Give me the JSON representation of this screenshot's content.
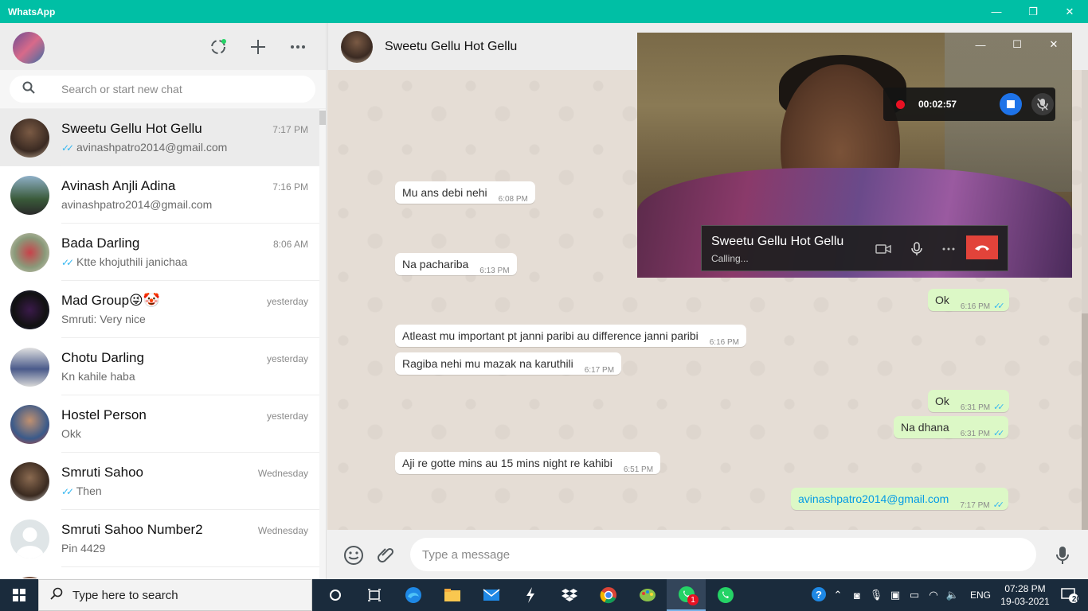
{
  "app": {
    "title": "WhatsApp",
    "window_controls": {
      "minimize": "—",
      "restore": "❐",
      "close": "✕"
    }
  },
  "colors": {
    "brand": "#00bfa5",
    "outgoing_bubble": "#dcf8c6",
    "incoming_bubble": "#ffffff",
    "read_ticks": "#34b7f1",
    "end_call": "#e2433a"
  },
  "left_header": {
    "status_icon": "status-icon",
    "new_chat_icon": "plus-icon",
    "menu_icon": "more-icon"
  },
  "search": {
    "placeholder": "Search or start new chat"
  },
  "chats": [
    {
      "name": "Sweetu Gellu Hot Gellu",
      "time": "7:17 PM",
      "last": "avinashpatro2014@gmail.com",
      "ticks": "✓✓",
      "active": true
    },
    {
      "name": "Avinash Anjli Adina",
      "time": "7:16 PM",
      "last": "avinashpatro2014@gmail.com",
      "ticks": ""
    },
    {
      "name": "Bada Darling",
      "time": "8:06 AM",
      "last": "Ktte khojuthili janichaa",
      "ticks": "✓✓"
    },
    {
      "name": "Mad Group😜🤡",
      "time": "yesterday",
      "last": "Smruti: Very nice",
      "ticks": ""
    },
    {
      "name": "Chotu Darling",
      "time": "yesterday",
      "last": "Kn kahile haba",
      "ticks": ""
    },
    {
      "name": "Hostel Person",
      "time": "yesterday",
      "last": "Okk",
      "ticks": ""
    },
    {
      "name": "Smruti Sahoo",
      "time": "Wednesday",
      "last": "Then",
      "ticks": "✓✓"
    },
    {
      "name": "Smruti Sahoo Number2",
      "time": "Wednesday",
      "last": "Pin  4429",
      "ticks": ""
    }
  ],
  "conversation": {
    "name": "Sweetu Gellu Hot Gellu",
    "messages": [
      {
        "dir": "in",
        "text": "Mu ans debi nehi",
        "time": "6:08 PM"
      },
      {
        "dir": "in",
        "text": "Na  pachariba",
        "time": "6:13 PM"
      },
      {
        "dir": "out",
        "text": "Ok",
        "time": "6:16 PM",
        "ticks": "✓✓"
      },
      {
        "dir": "in",
        "text": "Atleast mu important pt janni paribi au difference janni paribi",
        "time": "6:16 PM"
      },
      {
        "dir": "in",
        "text": "Ragiba nehi mu mazak na karuthili",
        "time": "6:17 PM"
      },
      {
        "dir": "out",
        "text": "Ok",
        "time": "6:31 PM",
        "ticks": "✓✓"
      },
      {
        "dir": "out",
        "text": "Na dhana",
        "time": "6:31 PM",
        "ticks": "✓✓"
      },
      {
        "dir": "in",
        "text": "Aji re gotte mins au 15 mins night re kahibi",
        "time": "6:51 PM"
      },
      {
        "dir": "out",
        "text": "avinashpatro2014@gmail.com",
        "time": "7:17 PM",
        "ticks": "✓✓"
      }
    ]
  },
  "compose": {
    "placeholder": "Type a message",
    "emoji_icon": "emoji-icon",
    "attach_icon": "paperclip-icon",
    "mic_icon": "mic-icon"
  },
  "video_call": {
    "recording_time": "00:02:57",
    "caller_name": "Sweetu Gellu Hot Gellu",
    "status": "Calling...",
    "window_controls": {
      "minimize": "—",
      "maximize": "☐",
      "close": "✕"
    }
  },
  "taskbar": {
    "search_placeholder": "Type here to search",
    "language": "ENG",
    "time": "07:28 PM",
    "date": "19-03-2021",
    "notification_count": "20",
    "whatsapp_badge": "1"
  }
}
